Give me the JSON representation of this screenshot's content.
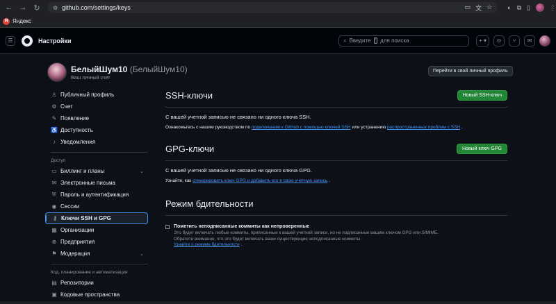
{
  "browser": {
    "url": "github.com/settings/keys",
    "bookmark": "Яндекс"
  },
  "header": {
    "title": "Настройки",
    "search_placeholder_before": "Введите",
    "search_key": "/",
    "search_placeholder_after": "для поиска"
  },
  "profile": {
    "name": "БелыйШум10",
    "login": "(БелыйШум10)",
    "subtitle": "Ваш личный счет",
    "goto_button": "Перейти в свой личный профиль"
  },
  "sidebar": {
    "items": [
      {
        "label": "Публичный профиль",
        "icon": "person-icon"
      },
      {
        "label": "Счет",
        "icon": "gear-icon"
      },
      {
        "label": "Появление",
        "icon": "paintbrush-icon"
      },
      {
        "label": "Доступность",
        "icon": "accessibility-icon"
      },
      {
        "label": "Уведомления",
        "icon": "bell-icon"
      }
    ],
    "heading_access": "Доступ",
    "access_items": [
      {
        "label": "Биллинг и планы",
        "icon": "credit-card-icon"
      },
      {
        "label": "Электронные письма",
        "icon": "mail-icon"
      },
      {
        "label": "Пароль и аутентификация",
        "icon": "shield-lock-icon"
      },
      {
        "label": "Сессии",
        "icon": "broadcast-icon"
      },
      {
        "label": "Ключи SSH и GPG",
        "icon": "key-icon"
      },
      {
        "label": "Организации",
        "icon": "organization-icon"
      },
      {
        "label": "Предприятия",
        "icon": "globe-icon"
      },
      {
        "label": "Модерация",
        "icon": "report-icon"
      }
    ],
    "heading_code": "Код, планирование и автоматизация",
    "code_items": [
      {
        "label": "Репозитории",
        "icon": "repo-icon"
      },
      {
        "label": "Кодовые пространства",
        "icon": "codespaces-icon"
      }
    ]
  },
  "ssh": {
    "title": "SSH-ключи",
    "button": "Новый SSH-ключ",
    "empty": "С вашей учетной записью не связано ни одного ключа SSH.",
    "help_prefix": "Ознакомьтесь с нашим руководством по",
    "help_link1": "подключению к GitHub с помощью ключей SSH",
    "help_mid": "или устранению",
    "help_link2": "распространенных проблем с SSH",
    "help_suffix": "."
  },
  "gpg": {
    "title": "GPG-ключи",
    "button": "Новый ключ GPG",
    "empty": "С вашей учетной записью не связано ни одного ключа GPG.",
    "help_prefix": "Узнайте, как",
    "help_link": "сгенерировать ключ GPG и добавить его в свою учетную запись",
    "help_suffix": "."
  },
  "vigilant": {
    "title": "Режим бдительности",
    "checkbox_label": "Пометить неподписанные коммиты как непроверенные",
    "desc1": "Это будет включать любые коммиты, приписанные к вашей учетной записи, но не подписанные вашим ключом GPG или S/MIME.",
    "desc2": "Обратите внимание, что это будет включать ваши существующие неподписанные коммиты.",
    "link": "Узнайте о режиме бдительности",
    "link_suffix": "."
  }
}
